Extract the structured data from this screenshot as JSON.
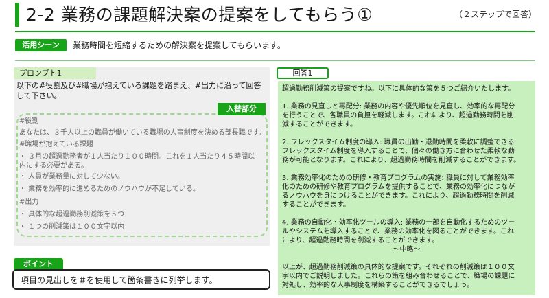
{
  "header": {
    "title": "2-2 業務の課題解決案の提案をしてもらう①",
    "subtitle": "（２ステップで回答）"
  },
  "usecase": {
    "tag": "活用シーン",
    "text": "業務時間を短縮するための解決案を提案してもらいます。"
  },
  "prompt": {
    "label": "プロンプト1",
    "instruction": "以下の#役割及び#職場が抱えている課題を踏まえ、#出力に沿って回答して下さい。",
    "replace_tag": "入替部分",
    "lines": [
      "#役割",
      "あなたは、３千人以上の職員が働いている職場の人事制度を決める部長職です。",
      "#職場が抱えている課題",
      "・ ３月の超過勤務者が１人当たり１００時間。これを１人当たり４５時間以",
      "内にする必要がある。",
      "・ 人員が業務量に対して少ない。",
      "・ 業務を効率的に進めるためのノウハウが不足している。",
      "#出力",
      "・ 具体的な超過勤務削減策を５つ",
      "・ １つの削減策は１００文字以内"
    ]
  },
  "point": {
    "tag": "ポイント",
    "text": "項目の見出しを＃を使用して箇条書きに列挙します。"
  },
  "answer": {
    "label": "回答1",
    "lines": [
      "超過勤務削減策の提案ですね。以下に具体的な策を５つご紹介いたします。",
      "",
      "1. 業務の見直しと再配分: 業務の内容や優先順位を見直し、効率的な再配分",
      "を行うことで、各職員の負担を軽減します。これにより、超過勤務時間を削",
      "減することができます。",
      "",
      "2. フレックスタイム制度の導入: 職員の出勤・退勤時間を柔軟に調整できる",
      "フレックスタイム制度を導入することで、個々の働き方に合わせた柔軟な勤",
      "務が可能となります。これにより、超過勤務時間を削減することができます。",
      "",
      "3. 業務効率化のための研修・教育プログラムの実施: 職員に対して業務効率",
      "化のための研修や教育プログラムを提供することで、業務の効率化につなが",
      "るノウハウを身につけることができます。これにより、超過勤務時間を削減",
      "することができます。",
      "",
      "4. 業務の自動化・効率化ツールの導入: 業務の一部を自動化するためのツー",
      "ルやシステムを導入することで、業務の効率化を図ることができます。これ",
      "により、超過勤務時間を削減することができます。",
      "～中略～",
      "",
      "以上が、超過勤務削減策の具体的な提案です。それぞれの削減策は１００文",
      "字以内でご説明しました。これらの策を組み合わせることで、職場の課題に",
      "対処し、効率的な人事制度を構築することができるでしょう。"
    ]
  },
  "colors": {
    "accent": "#18a418",
    "answer_bg": "#c8efbe",
    "prompt_bg": "#efefef",
    "prompt_label_bg": "#d4efc2",
    "replace_border": "#9fd88f"
  }
}
